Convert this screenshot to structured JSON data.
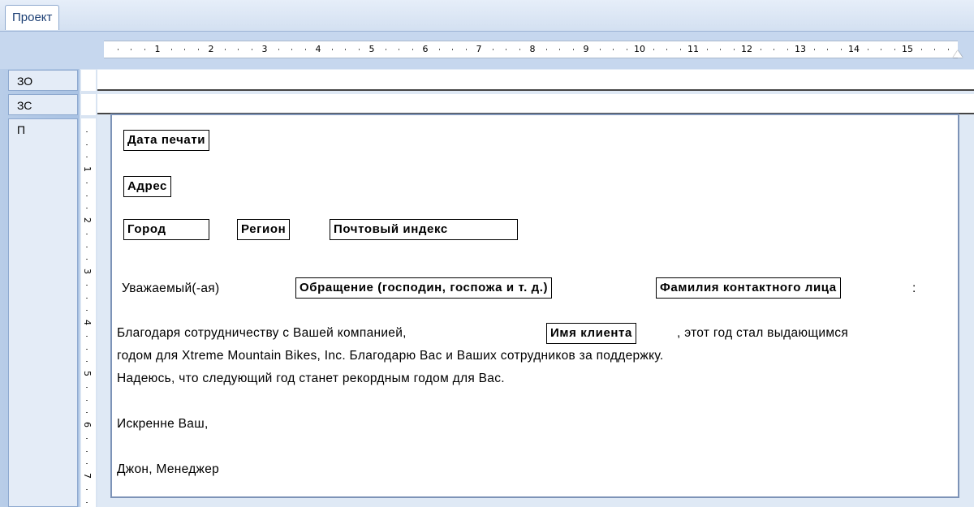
{
  "tabs": {
    "design_tab_label": "Проект"
  },
  "ruler": {
    "numbers": [
      "1",
      "2",
      "3",
      "4",
      "5",
      "6",
      "7",
      "8",
      "9",
      "10",
      "11",
      "12",
      "13",
      "14",
      "15"
    ]
  },
  "vruler": {
    "numbers": [
      "1",
      "2",
      "3",
      "4",
      "5",
      "6",
      "7"
    ]
  },
  "sections": {
    "report_header_label": "ЗО",
    "page_header_label": "ЗС",
    "details_label": "П"
  },
  "letter": {
    "print_date_field": "Дата печати",
    "address_field": "Адрес",
    "city_field": "Город",
    "region_field": "Регион",
    "postal_code_field": "Почтовый индекс",
    "greeting_text": "Уважаемый(-ая)",
    "title_field": "Обращение (господин, госпожа и т. д.)",
    "contact_last_name_field": "Фамилия контактного лица",
    "greeting_colon": ":",
    "body_line1_before": "Благодаря сотрудничеству с Вашей компанией,",
    "customer_name_field": "Имя клиента",
    "body_line1_after": ", этот год стал выдающимся",
    "body_line2": "годом для Xtreme Mountain Bikes, Inc. Благодарю Вас и Ваших сотрудников за поддержку.",
    "body_line3": "Надеюсь, что следующий год станет рекордным годом для Вас.",
    "closing": "Искренне Ваш,",
    "signature": "Джон, Менеджер"
  }
}
